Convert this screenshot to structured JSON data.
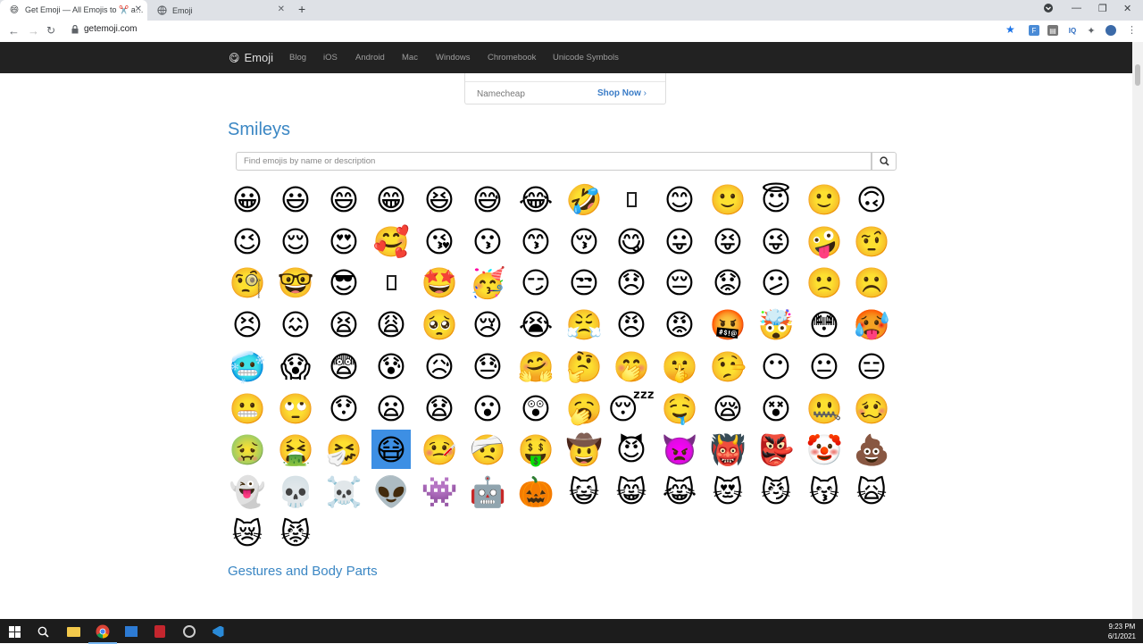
{
  "browser": {
    "tabs": [
      {
        "title": "Get Emoji — All Emojis to ✂️ a…",
        "favicon": "😄",
        "active": true
      },
      {
        "title": "Emoji",
        "favicon": "globe-icon",
        "active": false
      }
    ],
    "new_tab": "+",
    "url": "getemoji.com"
  },
  "site": {
    "brand": "Emoji",
    "brand_icon": "😋",
    "nav": [
      "Blog",
      "iOS",
      "Android",
      "Mac",
      "Windows",
      "Chromebook",
      "Unicode Symbols"
    ]
  },
  "ad": {
    "name": "Namecheap",
    "cta": "Shop Now"
  },
  "sections": {
    "smileys": {
      "title": "Smileys",
      "placeholder": "Find emojis by name or description",
      "rows": [
        [
          "😀",
          "😃",
          "😄",
          "😁",
          "😆",
          "😅",
          "😂",
          "🤣",
          "▯",
          "😊",
          "🙂",
          "😇",
          "🙂",
          "🙃"
        ],
        [
          "😉",
          "😌",
          "😍",
          "🥰",
          "😘",
          "😗",
          "😙",
          "😚",
          "😋",
          "😛",
          "😝",
          "😜",
          "🤪",
          "🤨"
        ],
        [
          "🧐",
          "🤓",
          "😎",
          "▯",
          "🤩",
          "🥳",
          "😏",
          "😒",
          "😞",
          "😔",
          "😟",
          "😕",
          "🙁",
          "☹️"
        ],
        [
          "😣",
          "😖",
          "😫",
          "😩",
          "🥺",
          "😢",
          "😭",
          "😤",
          "😠",
          "😡",
          "🤬",
          "🤯",
          "😳",
          "🥵"
        ],
        [
          "🥶",
          "😱",
          "😨",
          "😰",
          "😥",
          "😓",
          "🤗",
          "🤔",
          "🤭",
          "🤫",
          "🤥",
          "😶",
          "😐",
          "😑"
        ],
        [
          "😬",
          "🙄",
          "😯",
          "😦",
          "😧",
          "😮",
          "😲",
          "🥱",
          "😴",
          "🤤",
          "😪",
          "😵",
          "🤐",
          "🥴"
        ],
        [
          "🤢",
          "🤮",
          "🤧",
          "😷",
          "🤒",
          "🤕",
          "🤑",
          "🤠",
          "😈",
          "👿",
          "👹",
          "👺",
          "🤡",
          "💩"
        ],
        [
          "👻",
          "💀",
          "☠️",
          "👽",
          "👾",
          "🤖",
          "🎃",
          "😺",
          "😸",
          "😹",
          "😻",
          "😼",
          "😽",
          "🙀"
        ],
        [
          "😿",
          "😾"
        ]
      ]
    },
    "gestures": {
      "title": "Gestures and Body Parts",
      "rows": [
        [
          "👋",
          "🤚",
          "🖐",
          "✋",
          "🖖",
          "👌",
          "▯",
          "🤏",
          "✌️",
          "🤞",
          "🤟",
          "🤘",
          "🤙",
          "👈",
          "👉",
          "👆"
        ]
      ]
    }
  },
  "taskbar": {
    "time": "9:23 PM",
    "date": "6/1/2021"
  }
}
